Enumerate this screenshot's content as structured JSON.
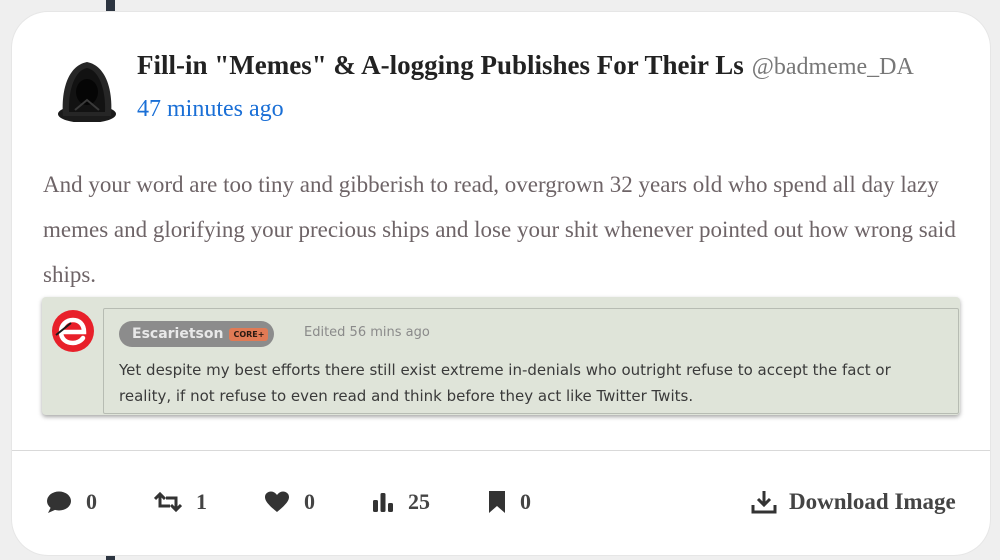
{
  "post": {
    "author_name": "Fill-in \"Memes\" & A-logging Publishes For Their Ls",
    "author_handle": "@badmeme_DA",
    "timestamp": "47 minutes ago",
    "text": "And your word are too tiny and gibberish to read, overgrown 32 years old who spend all day lazy memes and glorifying your precious ships and lose your shit whenever pointed out how wrong said ships."
  },
  "quote": {
    "username": "Escarietson",
    "badge": "CORE+",
    "edited": "Edited 56 mins ago",
    "text": "Yet despite my best efforts there still exist extreme in-denials who outright refuse to accept the fact or reality, if not refuse to even read and think before they act like Twitter Twits.",
    "logo_color": "#e8202a"
  },
  "actions": {
    "comments": "0",
    "reposts": "1",
    "likes": "0",
    "views": "25",
    "bookmarks": "0",
    "download_label": "Download Image"
  },
  "icons": [
    "comment-icon",
    "repost-icon",
    "heart-icon",
    "views-icon",
    "bookmark-icon",
    "download-icon"
  ],
  "colors": {
    "link": "#1a6fd6",
    "body_text": "#6e6467",
    "quote_bg": "#dfe4d9"
  }
}
